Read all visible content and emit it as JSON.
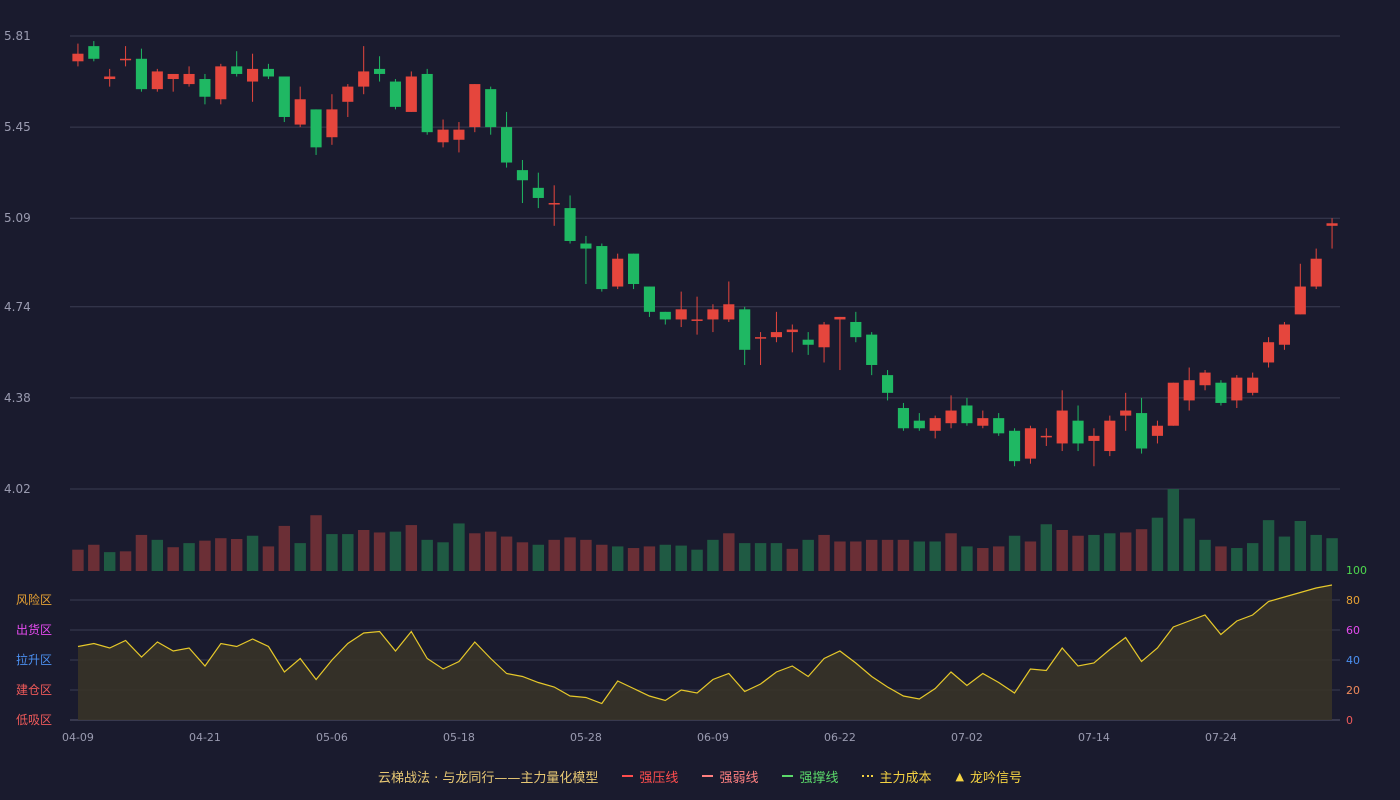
{
  "chart_data": {
    "type": "candlestick",
    "x_tick_labels": [
      "04-09",
      "04-21",
      "05-06",
      "05-18",
      "05-28",
      "06-09",
      "06-22",
      "07-02",
      "07-14",
      "07-24"
    ],
    "x_tick_index": [
      0,
      8,
      16,
      24,
      32,
      40,
      48,
      56,
      64,
      72
    ],
    "price_axis": {
      "ticks": [
        "5.81",
        "5.45",
        "5.09",
        "4.74",
        "4.38",
        "4.02"
      ],
      "ylim": [
        4.02,
        5.81
      ]
    },
    "candles": [
      [
        5.71,
        5.74,
        5.78,
        5.69
      ],
      [
        5.77,
        5.72,
        5.79,
        5.71
      ],
      [
        5.64,
        5.65,
        5.68,
        5.61
      ],
      [
        5.72,
        5.72,
        5.77,
        5.69
      ],
      [
        5.72,
        5.6,
        5.76,
        5.59
      ],
      [
        5.6,
        5.67,
        5.68,
        5.59
      ],
      [
        5.64,
        5.66,
        5.66,
        5.59
      ],
      [
        5.62,
        5.66,
        5.69,
        5.61
      ],
      [
        5.64,
        5.57,
        5.66,
        5.54
      ],
      [
        5.56,
        5.69,
        5.7,
        5.54
      ],
      [
        5.69,
        5.66,
        5.75,
        5.65
      ],
      [
        5.63,
        5.68,
        5.74,
        5.55
      ],
      [
        5.68,
        5.65,
        5.7,
        5.64
      ],
      [
        5.65,
        5.49,
        5.65,
        5.47
      ],
      [
        5.46,
        5.56,
        5.61,
        5.45
      ],
      [
        5.52,
        5.37,
        5.52,
        5.34
      ],
      [
        5.41,
        5.52,
        5.58,
        5.38
      ],
      [
        5.55,
        5.61,
        5.62,
        5.49
      ],
      [
        5.61,
        5.67,
        5.77,
        5.58
      ],
      [
        5.68,
        5.66,
        5.73,
        5.63
      ],
      [
        5.63,
        5.53,
        5.64,
        5.52
      ],
      [
        5.51,
        5.65,
        5.67,
        5.51
      ],
      [
        5.66,
        5.43,
        5.68,
        5.42
      ],
      [
        5.39,
        5.44,
        5.48,
        5.37
      ],
      [
        5.4,
        5.44,
        5.47,
        5.35
      ],
      [
        5.45,
        5.62,
        5.62,
        5.43
      ],
      [
        5.6,
        5.45,
        5.61,
        5.42
      ],
      [
        5.45,
        5.31,
        5.51,
        5.29
      ],
      [
        5.28,
        5.24,
        5.32,
        5.15
      ],
      [
        5.21,
        5.17,
        5.27,
        5.13
      ],
      [
        5.15,
        5.15,
        5.22,
        5.06
      ],
      [
        5.13,
        5.0,
        5.18,
        4.99
      ],
      [
        4.99,
        4.97,
        5.02,
        4.83
      ],
      [
        4.98,
        4.81,
        4.99,
        4.8
      ],
      [
        4.82,
        4.93,
        4.95,
        4.81
      ],
      [
        4.95,
        4.83,
        4.95,
        4.81
      ],
      [
        4.82,
        4.72,
        4.82,
        4.7
      ],
      [
        4.72,
        4.69,
        4.72,
        4.67
      ],
      [
        4.69,
        4.73,
        4.8,
        4.66
      ],
      [
        4.69,
        4.69,
        4.78,
        4.63
      ],
      [
        4.69,
        4.73,
        4.75,
        4.64
      ],
      [
        4.69,
        4.75,
        4.84,
        4.68
      ],
      [
        4.73,
        4.57,
        4.74,
        4.51
      ],
      [
        4.62,
        4.62,
        4.64,
        4.51
      ],
      [
        4.62,
        4.64,
        4.72,
        4.6
      ],
      [
        4.64,
        4.65,
        4.67,
        4.56
      ],
      [
        4.61,
        4.59,
        4.64,
        4.55
      ],
      [
        4.58,
        4.67,
        4.68,
        4.52
      ],
      [
        4.69,
        4.7,
        4.7,
        4.49
      ],
      [
        4.68,
        4.62,
        4.72,
        4.6
      ],
      [
        4.63,
        4.51,
        4.64,
        4.47
      ],
      [
        4.47,
        4.4,
        4.49,
        4.37
      ],
      [
        4.34,
        4.26,
        4.36,
        4.25
      ],
      [
        4.29,
        4.26,
        4.32,
        4.25
      ],
      [
        4.25,
        4.3,
        4.31,
        4.22
      ],
      [
        4.28,
        4.33,
        4.39,
        4.26
      ],
      [
        4.35,
        4.28,
        4.38,
        4.27
      ],
      [
        4.27,
        4.3,
        4.33,
        4.26
      ],
      [
        4.3,
        4.24,
        4.32,
        4.23
      ],
      [
        4.25,
        4.13,
        4.26,
        4.11
      ],
      [
        4.14,
        4.26,
        4.27,
        4.12
      ],
      [
        4.23,
        4.23,
        4.26,
        4.19
      ],
      [
        4.2,
        4.33,
        4.41,
        4.17
      ],
      [
        4.29,
        4.2,
        4.35,
        4.17
      ],
      [
        4.21,
        4.23,
        4.26,
        4.11
      ],
      [
        4.17,
        4.29,
        4.31,
        4.15
      ],
      [
        4.31,
        4.33,
        4.4,
        4.25
      ],
      [
        4.32,
        4.18,
        4.38,
        4.16
      ],
      [
        4.23,
        4.27,
        4.29,
        4.2
      ],
      [
        4.27,
        4.44,
        4.44,
        4.27
      ],
      [
        4.37,
        4.45,
        4.5,
        4.33
      ],
      [
        4.43,
        4.48,
        4.49,
        4.41
      ],
      [
        4.44,
        4.36,
        4.45,
        4.35
      ],
      [
        4.37,
        4.46,
        4.47,
        4.34
      ],
      [
        4.4,
        4.46,
        4.48,
        4.39
      ],
      [
        4.52,
        4.6,
        4.62,
        4.5
      ],
      [
        4.59,
        4.67,
        4.68,
        4.57
      ],
      [
        4.71,
        4.82,
        4.91,
        4.71
      ],
      [
        4.82,
        4.93,
        4.97,
        4.81
      ],
      [
        5.06,
        5.07,
        5.09,
        4.97
      ]
    ],
    "volumes": [
      26,
      32,
      23,
      24,
      44,
      38,
      29,
      34,
      37,
      40,
      39,
      43,
      30,
      55,
      34,
      68,
      45,
      45,
      50,
      47,
      48,
      56,
      38,
      35,
      58,
      46,
      48,
      42,
      35,
      32,
      38,
      41,
      38,
      32,
      30,
      28,
      30,
      32,
      31,
      26,
      38,
      46,
      34,
      34,
      34,
      27,
      38,
      44,
      36,
      36,
      38,
      38,
      38,
      36,
      36,
      46,
      30,
      28,
      30,
      43,
      36,
      57,
      50,
      43,
      44,
      46,
      47,
      51,
      65,
      100,
      64,
      38,
      30,
      28,
      34,
      62,
      42,
      61,
      44,
      40
    ],
    "volume_colors": [
      "up",
      "up",
      "down",
      "up",
      "up",
      "down",
      "up",
      "down",
      "up",
      "up",
      "up",
      "down",
      "up",
      "up",
      "down",
      "up",
      "down",
      "down",
      "up",
      "up",
      "down",
      "up",
      "down",
      "down",
      "down",
      "up",
      "up",
      "up",
      "up",
      "down",
      "up",
      "up",
      "up",
      "up",
      "down",
      "up",
      "up",
      "down",
      "down",
      "down",
      "down",
      "up",
      "down",
      "down",
      "down",
      "up",
      "down",
      "up",
      "up",
      "up",
      "up",
      "up",
      "up",
      "down",
      "down",
      "up",
      "down",
      "up",
      "up",
      "down",
      "up",
      "down",
      "up",
      "up",
      "down",
      "down",
      "up",
      "up",
      "down",
      "down",
      "down",
      "down",
      "up",
      "down",
      "down",
      "down",
      "down",
      "down",
      "down",
      "down"
    ],
    "indicator": {
      "ylim": [
        0,
        100
      ],
      "ticks": [
        "100",
        "80",
        "60",
        "40",
        "20",
        "0"
      ],
      "values": [
        49,
        51,
        48,
        53,
        42,
        52,
        46,
        48,
        36,
        51,
        49,
        54,
        49,
        32,
        41,
        27,
        40,
        51,
        58,
        59,
        46,
        59,
        41,
        34,
        39,
        52,
        41,
        31,
        29,
        25,
        22,
        16,
        15,
        11,
        26,
        21,
        16,
        13,
        20,
        18,
        27,
        31,
        19,
        24,
        32,
        36,
        29,
        41,
        46,
        38,
        29,
        22,
        16,
        14,
        21,
        32,
        23,
        31,
        25,
        18,
        34,
        33,
        48,
        36,
        38,
        47,
        55,
        39,
        48,
        62,
        66,
        70,
        57,
        66,
        70,
        79,
        82,
        85,
        88,
        90
      ]
    },
    "zone_labels": [
      "风险区",
      "出货区",
      "拉升区",
      "建仓区",
      "低吸区"
    ],
    "zone_colors": [
      "#e8a233",
      "#e64bf0",
      "#4b8ff0",
      "#ef5a5a",
      "#ef5a5a"
    ],
    "colors": {
      "up": "#e5463d",
      "down": "#1fb863",
      "line": "#e6c82a"
    }
  },
  "legend": {
    "title": "云梯战法 · 与龙同行——主力量化模型",
    "items": [
      {
        "label": "强压线",
        "color": "#ff4d4d",
        "style": "solid"
      },
      {
        "label": "强弱线",
        "color": "#ff8080",
        "style": "dash"
      },
      {
        "label": "强撑线",
        "color": "#5bd96a",
        "style": "solid"
      },
      {
        "label": "主力成本",
        "color": "#f5d342",
        "style": "dot"
      },
      {
        "label": "龙吟信号",
        "color": "#f5d342",
        "style": "triangle",
        "icon": "▲"
      }
    ]
  }
}
